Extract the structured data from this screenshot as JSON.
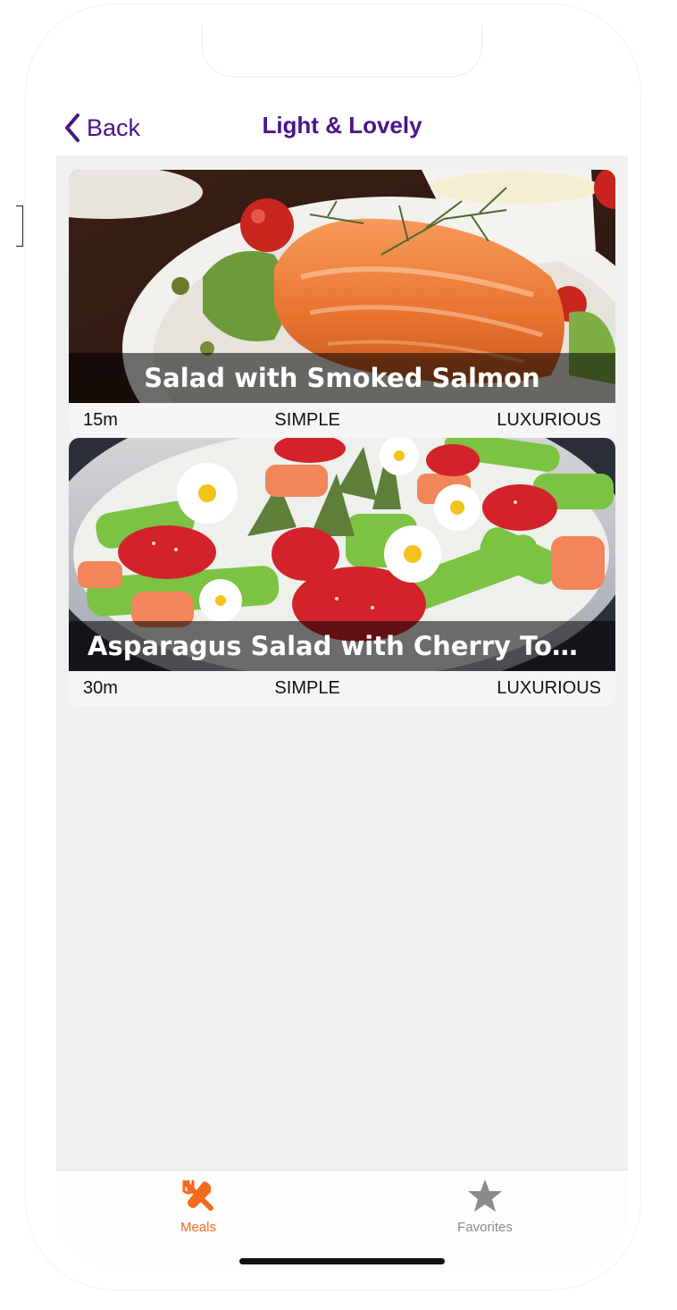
{
  "navbar": {
    "back_label": "Back",
    "title": "Light & Lovely"
  },
  "meals": [
    {
      "title": "Salad with Smoked Salmon",
      "duration": "15m",
      "complexity": "SIMPLE",
      "affordability": "LUXURIOUS"
    },
    {
      "title": "Asparagus Salad with Cherry Tomat...",
      "duration": "30m",
      "complexity": "SIMPLE",
      "affordability": "LUXURIOUS"
    }
  ],
  "tabbar": {
    "tabs": [
      {
        "label": "Meals",
        "icon": "cutlery-icon",
        "active": true
      },
      {
        "label": "Favorites",
        "icon": "star-icon",
        "active": false
      }
    ]
  },
  "colors": {
    "primary": "#4a148c",
    "accent": "#f26b1d",
    "inactive": "#8a8a8a",
    "background": "#f0f0f0"
  }
}
